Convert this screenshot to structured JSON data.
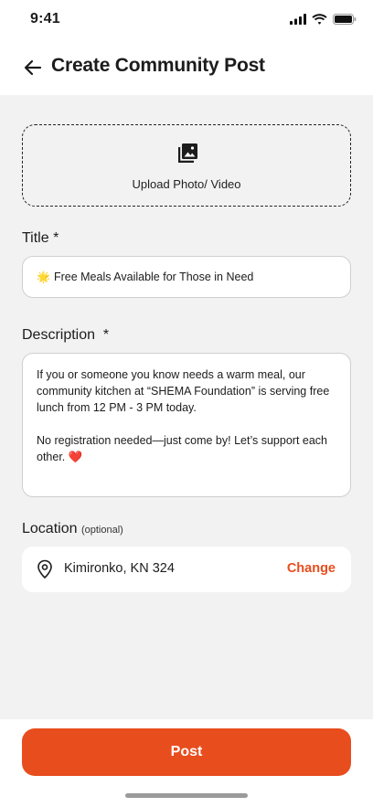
{
  "status_bar": {
    "time": "9:41",
    "signal_icon": "cellular-signal-icon",
    "wifi_icon": "wifi-icon",
    "battery_icon": "battery-icon"
  },
  "header": {
    "back_icon": "arrow-left-icon",
    "title": "Create Community Post"
  },
  "upload": {
    "icon": "photo-library-icon",
    "label": "Upload Photo/ Video"
  },
  "title_field": {
    "label": "Title *",
    "emoji": "🌟",
    "value": "Free Meals Available for Those in Need"
  },
  "description_field": {
    "label": "Description  *",
    "paragraph1": "If you or someone you know needs a warm meal, our community kitchen at “SHEMA Foundation” is serving free lunch from 12 PM - 3 PM today.",
    "paragraph2": "No registration needed—just come by! Let’s support each other. ❤️"
  },
  "location_field": {
    "label": "Location",
    "optional": "(optional)",
    "pin_icon": "location-pin-icon",
    "value": "Kimironko, KN 324",
    "change_label": "Change"
  },
  "footer": {
    "post_label": "Post"
  },
  "colors": {
    "accent": "#e84d1e",
    "background": "#f2f2f2"
  }
}
